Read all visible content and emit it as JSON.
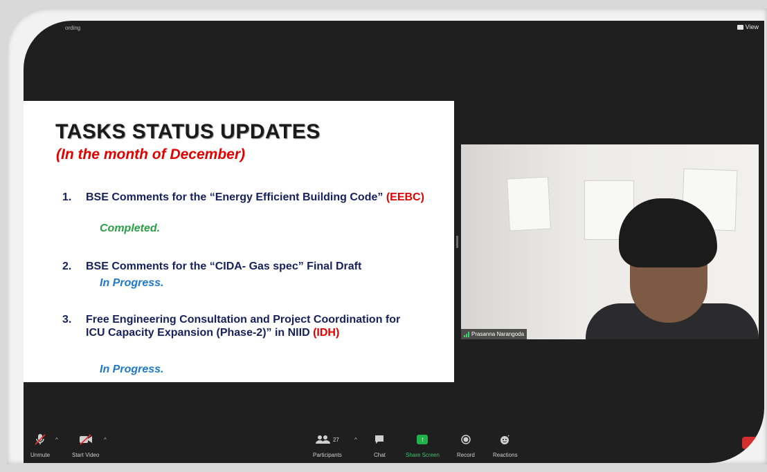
{
  "window": {
    "top_left_label": "ording",
    "view_label": "View"
  },
  "slide": {
    "title": "TASKS STATUS UPDATES",
    "subtitle": "(In the month of December)",
    "tasks": [
      {
        "number": "1.",
        "text_a": "BSE Comments for the “Energy Efficient Building Code”",
        "text_red": "(EEBC)",
        "text_b": "",
        "status": "Completed."
      },
      {
        "number": "2.",
        "text_a": "BSE Comments for the “CIDA- Gas spec” Final Draft",
        "text_red": "",
        "text_b": "",
        "status": "In Progress."
      },
      {
        "number": "3.",
        "text_a": "Free Engineering Consultation and Project Coordination for ICU Capacity Expansion (Phase-2)” in NIID",
        "text_red": "(IDH)",
        "text_b": "",
        "status": "In Progress."
      }
    ]
  },
  "video": {
    "participant_name": "Prasanna Narangoda"
  },
  "toolbar": {
    "unmute": "Unmute",
    "start_video": "Start Video",
    "participants": "Participants",
    "participant_count": "27",
    "chat": "Chat",
    "share_screen": "Share Screen",
    "record": "Record",
    "reactions": "Reactions"
  },
  "colors": {
    "status_completed": "#2aa045",
    "status_in_progress": "#1f78c8",
    "highlight_red": "#e00000",
    "task_text": "#16215c",
    "share_green": "#22b24c"
  }
}
